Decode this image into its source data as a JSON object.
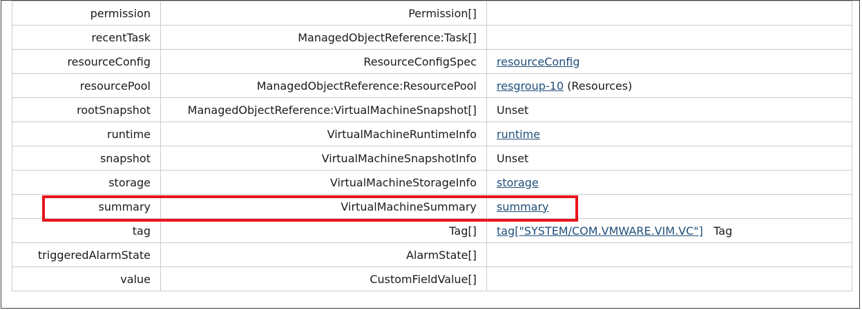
{
  "rows": [
    {
      "name": "permission",
      "type": "Permission[]",
      "value": "",
      "link": "",
      "suffix": ""
    },
    {
      "name": "recentTask",
      "type": "ManagedObjectReference:Task[]",
      "value": "",
      "link": "",
      "suffix": ""
    },
    {
      "name": "resourceConfig",
      "type": "ResourceConfigSpec",
      "value": "",
      "link": "resourceConfig",
      "suffix": ""
    },
    {
      "name": "resourcePool",
      "type": "ManagedObjectReference:ResourcePool",
      "value": "",
      "link": "resgroup-10",
      "suffix": " (Resources)"
    },
    {
      "name": "rootSnapshot",
      "type": "ManagedObjectReference:VirtualMachineSnapshot[]",
      "value": "Unset",
      "link": "",
      "suffix": ""
    },
    {
      "name": "runtime",
      "type": "VirtualMachineRuntimeInfo",
      "value": "",
      "link": "runtime",
      "suffix": ""
    },
    {
      "name": "snapshot",
      "type": "VirtualMachineSnapshotInfo",
      "value": "Unset",
      "link": "",
      "suffix": ""
    },
    {
      "name": "storage",
      "type": "VirtualMachineStorageInfo",
      "value": "",
      "link": "storage",
      "suffix": ""
    },
    {
      "name": "summary",
      "type": "VirtualMachineSummary",
      "value": "",
      "link": "summary",
      "suffix": ""
    },
    {
      "name": "tag",
      "type": "Tag[]",
      "value": "",
      "link": "tag[\"SYSTEM/COM.VMWARE.VIM.VC\"]",
      "suffix": "   Tag"
    },
    {
      "name": "triggeredAlarmState",
      "type": "AlarmState[]",
      "value": "",
      "link": "",
      "suffix": ""
    },
    {
      "name": "value",
      "type": "CustomFieldValue[]",
      "value": "",
      "link": "",
      "suffix": ""
    }
  ],
  "highlight": {
    "row": "summary",
    "color": "#e8141a"
  }
}
